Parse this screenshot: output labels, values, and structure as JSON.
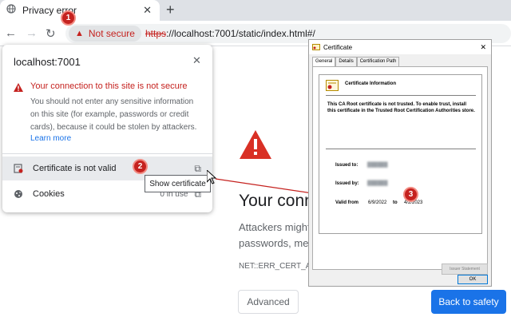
{
  "tab": {
    "title": "Privacy error"
  },
  "omnibox": {
    "security_chip": "Not secure",
    "url_scheme": "https",
    "url_rest": "://localhost:7001/static/index.html#/"
  },
  "interstitial": {
    "heading": "Your conn",
    "para_line1": "Attackers might",
    "para_line2": "passwords, mes",
    "error_code": "NET::ERR_CERT_AUT",
    "advanced_label": "Advanced",
    "back_label": "Back to safety"
  },
  "site_info": {
    "host": "localhost:7001",
    "warning_title": "Your connection to this site is not secure",
    "warning_desc": "You should not enter any sensitive information on this site (for example, passwords or credit cards), because it could be stolen by attackers.",
    "learn_more": "Learn more",
    "cert_row": "Certificate is not valid",
    "cookies_row": "Cookies",
    "cookies_status": "0 in use"
  },
  "tooltip": "Show certificate",
  "callouts": [
    "1",
    "2",
    "3"
  ],
  "certificate_dialog": {
    "title": "Certificate",
    "tabs": [
      "General",
      "Details",
      "Certification Path"
    ],
    "info_title": "Certificate Information",
    "warning": "This CA Root certificate is not trusted. To enable trust, install this certificate in the Trusted Root Certification Authorities store.",
    "issued_to_label": "Issued to:",
    "issued_by_label": "Issued by:",
    "valid_from_label": "Valid from",
    "valid_from": "6/9/2022",
    "to_label": "to",
    "valid_to": "4/2/2023",
    "issuer_statement": "Issuer Statement",
    "ok": "OK"
  },
  "colors": {
    "danger": "#c5221f",
    "primary": "#1a73e8"
  }
}
